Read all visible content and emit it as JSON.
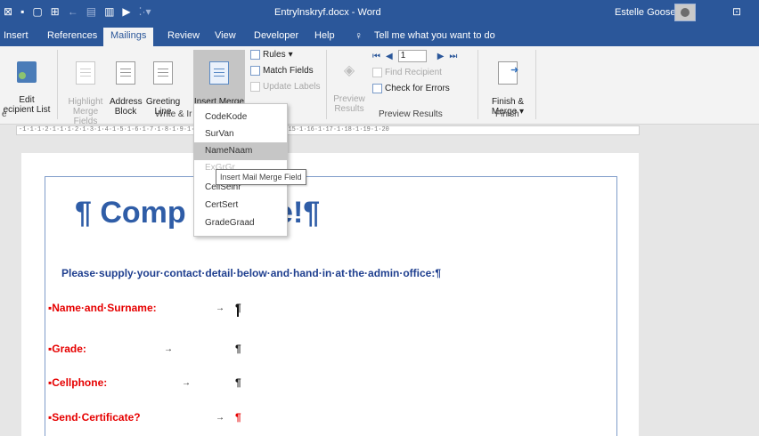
{
  "titlebar": {
    "qat_icons": [
      "word-logo-icon",
      "save-icon",
      "new-doc-icon",
      "table-icon",
      "undo-icon",
      "redo-icon",
      "layout-icon",
      "flag-icon",
      "customize-icon"
    ],
    "doc_title": "Entrylnskryf.docx  -  Word",
    "user_name": "Estelle Goosen"
  },
  "tabs": {
    "items": [
      {
        "label": "Insert"
      },
      {
        "label": "References"
      },
      {
        "label": "Mailings"
      },
      {
        "label": "Review"
      },
      {
        "label": "View"
      },
      {
        "label": "Developer"
      },
      {
        "label": "Help"
      },
      {
        "label": "Tell me what you want to do"
      }
    ],
    "active": "Mailings"
  },
  "ribbon": {
    "edit_recipient": "Edit\necipient List",
    "highlight_merge": "Highlight\nMerge Fields",
    "address_block": "Address\nBlock",
    "greeting_line": "Greeting\nLine",
    "insert_merge_field": "Insert Merge\nField",
    "rules": "Rules",
    "match_fields": "Match Fields",
    "update_labels": "Update Labels",
    "preview_results": "Preview\nResults",
    "record_number": "1",
    "find_recipient": "Find Recipient",
    "check_errors": "Check for Errors",
    "finish_merge": "Finish &\nMerge",
    "group_write": "Write & Ir",
    "group_preview": "Preview Results",
    "group_finish": "Finish",
    "group_left_fragment": "e"
  },
  "ruler": {
    "text": "-1·1·1·2·1·1·1·2·1·3·1·4·1·5·1·6·1·7·1·8·1·9·1·10·1·11·1·12·1·13·1·14·1·15·1·16·1·17·1·18·1·19·1·20"
  },
  "document": {
    "heading": "¶ Comp             n·Time!¶",
    "subheading": "Please·supply·your·contact·detail·below·and·hand·in·at·the·admin·office:¶",
    "fields": [
      {
        "label": "▪Name·and·Surname:",
        "arrow": "→",
        "pilcrow": "¶"
      },
      {
        "label": "▪Grade:",
        "arrow": "→",
        "pilcrow": "¶"
      },
      {
        "label": "▪Cellphone:",
        "arrow": "→",
        "pilcrow": "¶"
      },
      {
        "label": "▪Send·Certificate?",
        "arrow": "→",
        "pilcrow": "¶"
      }
    ]
  },
  "merge_field_menu": {
    "items": [
      "CodeKode",
      "SurVan",
      "NameNaam",
      "ExGrGr",
      "CellSelnr",
      "CertSert",
      "GradeGraad"
    ],
    "highlighted": "NameNaam",
    "tooltip": "Insert Mail Merge Field"
  }
}
